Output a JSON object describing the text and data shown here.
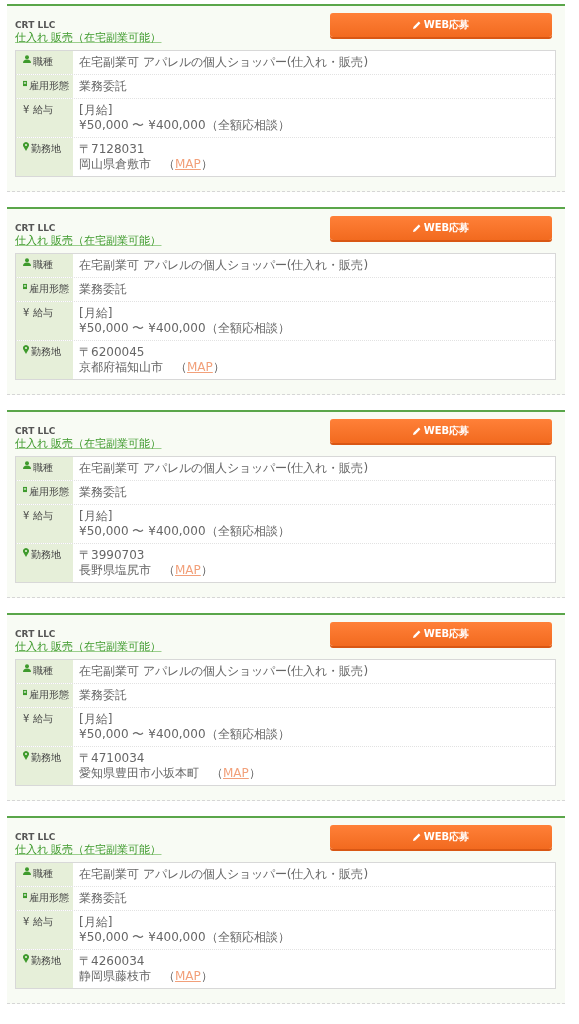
{
  "jobs": [
    {
      "company": "CRT LLC",
      "title": "仕入れ 販売（在宅副業可能）",
      "apply_button": "WEB応募",
      "rows": [
        {
          "kind": "job_type",
          "label": "職種",
          "lines": [
            "在宅副業可 アパレルの個人ショッパー(仕入れ・販売)"
          ]
        },
        {
          "kind": "employment",
          "label": "雇用形態",
          "lines": [
            "業務委託"
          ]
        },
        {
          "kind": "salary",
          "label": "¥ 給与",
          "lines": [
            "[月給]",
            "¥50,000 〜 ¥400,000（全額応相談）"
          ]
        },
        {
          "kind": "location",
          "label": "勤務地",
          "lines": [
            "〒7128031"
          ],
          "address": "岡山県倉敷市　（",
          "map_link": "MAP",
          "address_end": "）"
        }
      ]
    },
    {
      "company": "CRT LLC",
      "title": "仕入れ 販売（在宅副業可能）",
      "apply_button": "WEB応募",
      "rows": [
        {
          "kind": "job_type",
          "label": "職種",
          "lines": [
            "在宅副業可 アパレルの個人ショッパー(仕入れ・販売)"
          ]
        },
        {
          "kind": "employment",
          "label": "雇用形態",
          "lines": [
            "業務委託"
          ]
        },
        {
          "kind": "salary",
          "label": "¥ 給与",
          "lines": [
            "[月給]",
            "¥50,000 〜 ¥400,000（全額応相談）"
          ]
        },
        {
          "kind": "location",
          "label": "勤務地",
          "lines": [
            "〒6200045"
          ],
          "address": "京都府福知山市　（",
          "map_link": "MAP",
          "address_end": "）"
        }
      ]
    },
    {
      "company": "CRT LLC",
      "title": "仕入れ 販売（在宅副業可能）",
      "apply_button": "WEB応募",
      "rows": [
        {
          "kind": "job_type",
          "label": "職種",
          "lines": [
            "在宅副業可 アパレルの個人ショッパー(仕入れ・販売)"
          ]
        },
        {
          "kind": "employment",
          "label": "雇用形態",
          "lines": [
            "業務委託"
          ]
        },
        {
          "kind": "salary",
          "label": "¥ 給与",
          "lines": [
            "[月給]",
            "¥50,000 〜 ¥400,000（全額応相談）"
          ]
        },
        {
          "kind": "location",
          "label": "勤務地",
          "lines": [
            "〒3990703"
          ],
          "address": "長野県塩尻市　（",
          "map_link": "MAP",
          "address_end": "）"
        }
      ]
    },
    {
      "company": "CRT LLC",
      "title": "仕入れ 販売（在宅副業可能）",
      "apply_button": "WEB応募",
      "rows": [
        {
          "kind": "job_type",
          "label": "職種",
          "lines": [
            "在宅副業可 アパレルの個人ショッパー(仕入れ・販売)"
          ]
        },
        {
          "kind": "employment",
          "label": "雇用形態",
          "lines": [
            "業務委託"
          ]
        },
        {
          "kind": "salary",
          "label": "¥ 給与",
          "lines": [
            "[月給]",
            "¥50,000 〜 ¥400,000（全額応相談）"
          ]
        },
        {
          "kind": "location",
          "label": "勤務地",
          "lines": [
            "〒4710034"
          ],
          "address": "愛知県豊田市小坂本町　（",
          "map_link": "MAP",
          "address_end": "）"
        }
      ]
    },
    {
      "company": "CRT LLC",
      "title": "仕入れ 販売（在宅副業可能）",
      "apply_button": "WEB応募",
      "rows": [
        {
          "kind": "job_type",
          "label": "職種",
          "lines": [
            "在宅副業可 アパレルの個人ショッパー(仕入れ・販売)"
          ]
        },
        {
          "kind": "employment",
          "label": "雇用形態",
          "lines": [
            "業務委託"
          ]
        },
        {
          "kind": "salary",
          "label": "¥ 給与",
          "lines": [
            "[月給]",
            "¥50,000 〜 ¥400,000（全額応相談）"
          ]
        },
        {
          "kind": "location",
          "label": "勤務地",
          "lines": [
            "〒4260034"
          ],
          "address": "静岡県藤枝市　（",
          "map_link": "MAP",
          "address_end": "）"
        }
      ]
    }
  ]
}
